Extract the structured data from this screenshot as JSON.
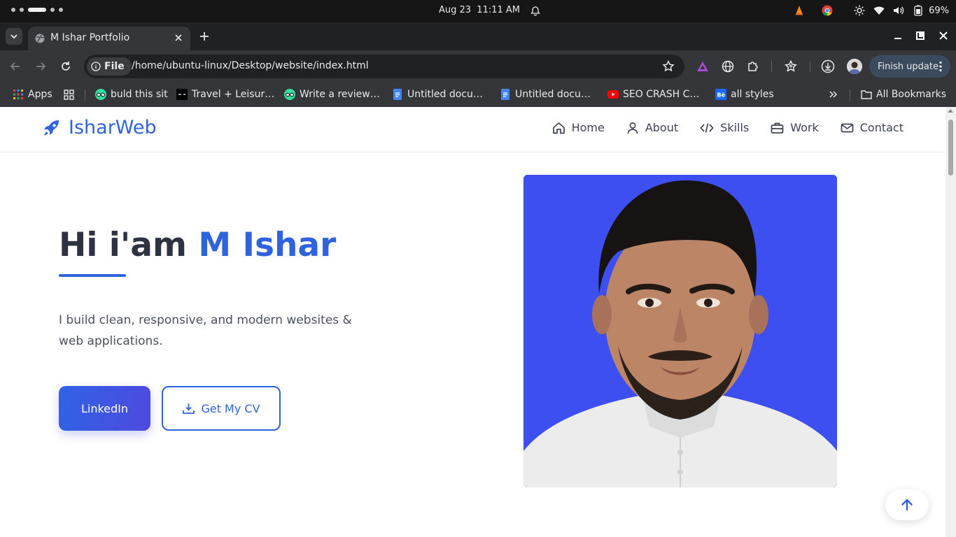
{
  "os": {
    "date": "Aug 23",
    "time": "11:11 AM",
    "battery_percent": "69%"
  },
  "browser": {
    "tab": {
      "title": "M Ishar Portfolio"
    },
    "address": {
      "scheme_label": "File",
      "url": "/home/ubuntu-linux/Desktop/website/index.html"
    },
    "finish_update_label": "Finish update",
    "bookmarks": [
      {
        "label": "Apps",
        "icon": "apps-grid-icon"
      },
      {
        "label": "buld this sit",
        "icon": "tripadvisor-icon"
      },
      {
        "label": "Travel + Leisur…",
        "icon": "tl-icon"
      },
      {
        "label": "Write a review…",
        "icon": "tripadvisor-icon"
      },
      {
        "label": "Untitled docu…",
        "icon": "google-docs-icon"
      },
      {
        "label": "Untitled docu…",
        "icon": "google-docs-icon"
      },
      {
        "label": "SEO CRASH C…",
        "icon": "youtube-icon"
      },
      {
        "label": "all styles",
        "icon": "behance-icon"
      }
    ],
    "all_bookmarks_label": "All Bookmarks"
  },
  "site": {
    "logo_text": "IsharWeb",
    "nav": [
      {
        "label": "Home",
        "icon": "home-icon"
      },
      {
        "label": "About",
        "icon": "user-icon"
      },
      {
        "label": "Skills",
        "icon": "code-icon"
      },
      {
        "label": "Work",
        "icon": "briefcase-icon"
      },
      {
        "label": "Contact",
        "icon": "envelope-icon"
      }
    ],
    "hero": {
      "greeting": "Hi i'am ",
      "name": "M Ishar",
      "subtitle": "I build clean, responsive, and modern websites & web applications.",
      "linkedin_label": "LinkedIn",
      "cv_label": "Get My CV"
    }
  },
  "colors": {
    "accent": "#2f63de",
    "portrait_bg": "#3d4ff0",
    "chrome_dark": "#202124",
    "chrome_toolbar": "#35363a"
  }
}
